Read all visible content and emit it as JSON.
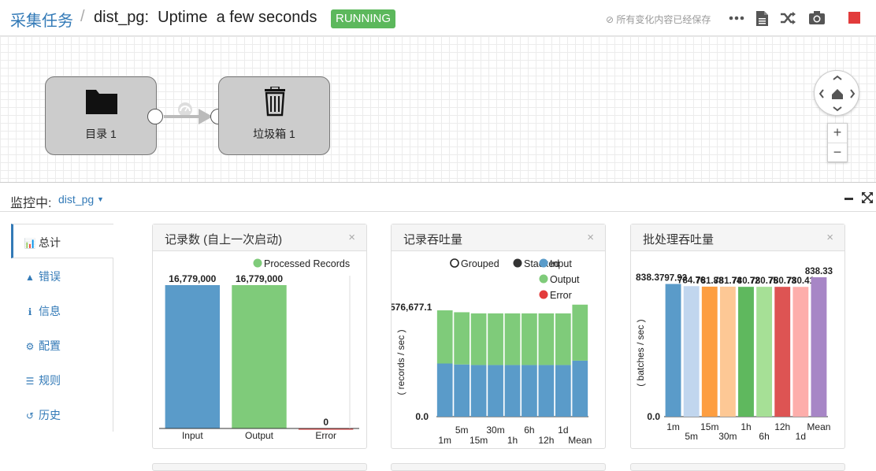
{
  "header": {
    "breadcrumb": "采集任务",
    "separator": "/",
    "pipeline_title": "dist_pg:  Uptime  a few seconds",
    "status": "RUNNING",
    "saved_text": "所有变化内容已经保存"
  },
  "canvas": {
    "nodes": [
      {
        "label": "目录 1",
        "icon": "folder-icon"
      },
      {
        "label": "垃圾箱 1",
        "icon": "trash-icon"
      }
    ]
  },
  "zoom": {
    "plus": "+",
    "minus": "−"
  },
  "monitor": {
    "label": "监控中:",
    "selected": "dist_pg"
  },
  "nav": {
    "items": [
      {
        "label": "总计",
        "icon": "bar-chart-icon",
        "active": true
      },
      {
        "label": "错误",
        "icon": "warning-icon",
        "active": false
      },
      {
        "label": "信息",
        "icon": "info-icon",
        "active": false
      },
      {
        "label": "配置",
        "icon": "gear-icon",
        "active": false
      },
      {
        "label": "规则",
        "icon": "list-icon",
        "active": false
      },
      {
        "label": "历史",
        "icon": "history-icon",
        "active": false
      }
    ]
  },
  "colors": {
    "blue": "#5a9bc9",
    "green": "#7fcb7a",
    "red": "#e33b3b",
    "link": "#337ab7",
    "running": "#5cb85c"
  },
  "panels": {
    "records": {
      "title": "记录数 (自上一次启动)",
      "close": "×"
    },
    "throughput": {
      "title": "记录吞吐量",
      "close": "×"
    },
    "batch": {
      "title": "批处理吞吐量",
      "close": "×"
    }
  },
  "chart_data": [
    {
      "type": "bar",
      "legend": [
        "Processed Records"
      ],
      "categories": [
        "Input",
        "Output",
        "Error"
      ],
      "values": [
        16779000,
        16779000,
        0
      ],
      "value_labels": [
        "16,779,000",
        "16,779,000",
        "0"
      ],
      "colors": [
        "#5a9bc9",
        "#7fcb7a",
        "#e33b3b"
      ],
      "ylim": [
        0,
        16779000
      ]
    },
    {
      "type": "bar",
      "stacked": true,
      "legend_controls": [
        "Grouped",
        "Stacked"
      ],
      "legend": [
        "Input",
        "Output",
        "Error"
      ],
      "ylabel": "( records / sec )",
      "y_ticks": [
        "0.0",
        "576,677.1"
      ],
      "ylim": [
        0,
        576677.1
      ],
      "categories": [
        "1m",
        "5m",
        "15m",
        "30m",
        "1h",
        "6h",
        "12h",
        "1d",
        "Mean"
      ],
      "series": [
        {
          "name": "Input",
          "color": "#5a9bc9",
          "values": [
            280000,
            275000,
            272000,
            272000,
            272000,
            272000,
            272000,
            272000,
            295000
          ]
        },
        {
          "name": "Output",
          "color": "#7fcb7a",
          "values": [
            280000,
            275000,
            272000,
            272000,
            272000,
            272000,
            272000,
            272000,
            295000
          ]
        },
        {
          "name": "Error",
          "color": "#e33b3b",
          "values": [
            0,
            0,
            0,
            0,
            0,
            0,
            0,
            0,
            0
          ]
        }
      ]
    },
    {
      "type": "bar",
      "ylabel": "( batches / sec )",
      "y_ticks": [
        "0.0",
        "838.3"
      ],
      "ylim": [
        0,
        838.33
      ],
      "categories": [
        "1m",
        "5m",
        "15m",
        "30m",
        "1h",
        "6h",
        "12h",
        "1d",
        "Mean"
      ],
      "values": [
        797.93,
        784.76,
        781.88,
        781.74,
        780.72,
        780.75,
        780.73,
        780.41,
        838.33
      ],
      "value_labels": [
        "797.93",
        "784.76",
        "781.88",
        "781.74",
        "780.72",
        "780.75",
        "780.73",
        "780.41",
        "838.33"
      ],
      "colors": [
        "#5a9bc9",
        "#c1d6ee",
        "#fd9e41",
        "#fdc895",
        "#5fb85e",
        "#a6e096",
        "#dd5453",
        "#fdaeab",
        "#a786c6"
      ]
    }
  ]
}
